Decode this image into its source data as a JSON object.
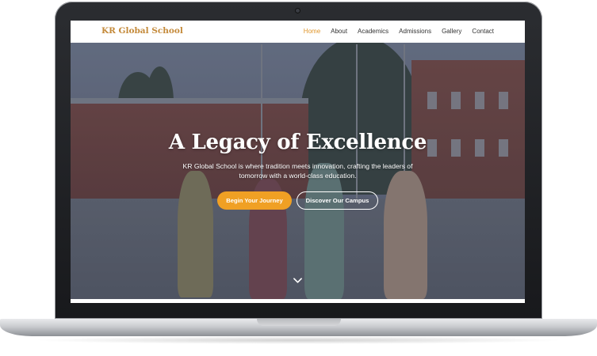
{
  "site": {
    "logo": "KR Global School",
    "nav": [
      "Home",
      "About",
      "Academics",
      "Admissions",
      "Gallery",
      "Contact"
    ],
    "active_nav": "Home"
  },
  "hero": {
    "title": "A Legacy of Excellence",
    "subtitle": "KR Global School is where tradition meets innovation, crafting the leaders of tomorrow with a world-class education.",
    "primary_button": "Begin Your Journey",
    "secondary_button": "Discover Our Campus"
  },
  "icons": {
    "scroll": "chevron-down-icon",
    "camera": "camera-icon"
  },
  "colors": {
    "accent": "#f0a024",
    "logo": "#c48a3a",
    "active_nav": "#e0952a"
  }
}
